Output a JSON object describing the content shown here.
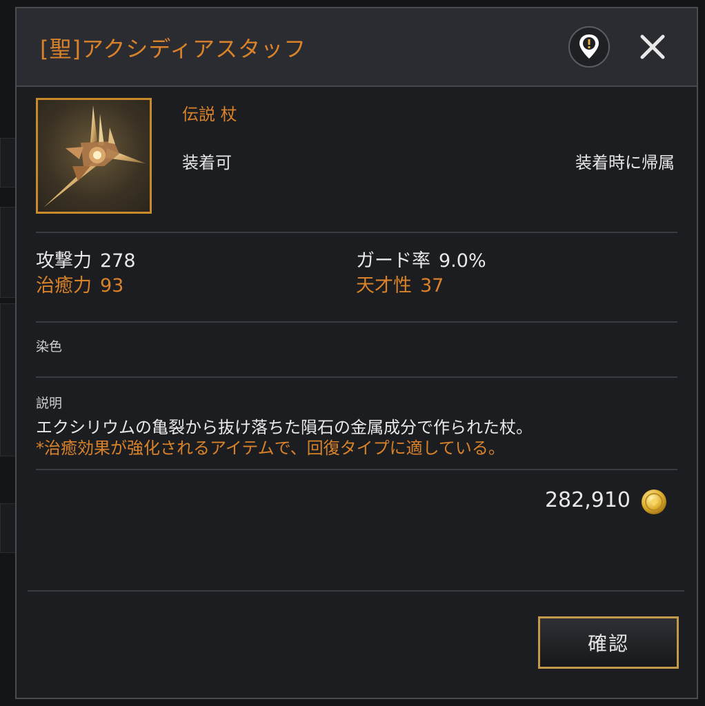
{
  "dialog": {
    "title": "[聖]アクシディアスタッフ"
  },
  "item": {
    "grade_type": "伝説 杖",
    "equip_status": "装着可",
    "bind_status": "装着時に帰属",
    "icon": "ornate-golden-staff-icon"
  },
  "stats": [
    {
      "label": "攻撃力",
      "value": "278",
      "color": "#e8e8e8"
    },
    {
      "label": "ガード率",
      "value": "9.0%",
      "color": "#e8e8e8"
    },
    {
      "label": "治癒力",
      "value": "93",
      "color": "#d9822a"
    },
    {
      "label": "天才性",
      "value": "37",
      "color": "#d9822a"
    }
  ],
  "dye": {
    "label": "染色"
  },
  "description": {
    "label": "説明",
    "line1": "エクシリウムの亀裂から抜け落ちた隕石の金属成分で作られた杖。",
    "line2": "*治癒効果が強化されるアイテムで、回復タイプに適している。"
  },
  "price": {
    "value": "282,910",
    "currency_icon": "gold-coin-icon"
  },
  "buttons": {
    "confirm": "確認",
    "alert_icon": "alert-marker-icon",
    "close_icon": "close-icon"
  },
  "colors": {
    "accent": "#d9822a",
    "panel": "#1c1d21",
    "header": "#2a2c31",
    "button_border": "#c49a4a"
  }
}
